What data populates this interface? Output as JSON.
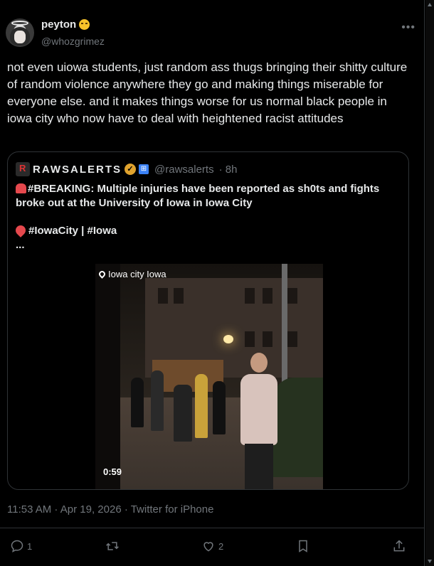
{
  "author": {
    "display_name": "peyton",
    "handle": "@whozgrimez",
    "emoji_icon": "disappointed-face-icon"
  },
  "tweet": {
    "text": "not even uiowa students, just random ass thugs bringing their shitty culture of random violence anywhere they go and making things miserable for everyone else. and it makes things worse for us normal black people in iowa city who now have to deal with heightened racist attitudes"
  },
  "quoted": {
    "display_name": "RAWSALERTS",
    "handle": "@rawsalerts",
    "time": "· 8h",
    "text": "#BREAKING: Multiple injuries have been reported as sh0ts and fights broke out at the University of Iowa in Iowa City",
    "tags": "#IowaCity | #Iowa",
    "ellipsis": "...",
    "video": {
      "location": "Iowa city Iowa",
      "duration": "0:59"
    }
  },
  "meta": {
    "timestamp": "11:53 AM · Apr 19, 2026 · Twitter for iPhone"
  },
  "actions": {
    "reply_count": "1",
    "retweet_count": "",
    "like_count": "2"
  },
  "colors": {
    "background": "#000000",
    "text": "#e7e9ea",
    "muted": "#71767b",
    "border": "#2f3336",
    "verified_gold": "#e0a32e"
  }
}
